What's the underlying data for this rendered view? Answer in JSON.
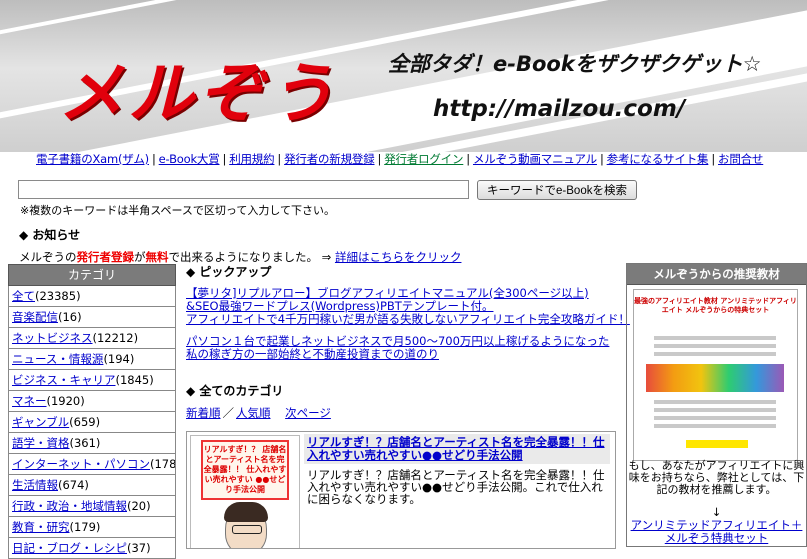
{
  "banner": {
    "logo": "メルぞう",
    "tagline": "全部タダ！e-Bookをザクザクゲット☆",
    "url": "http://mailzou.com/"
  },
  "nav": [
    {
      "label": "電子書籍のXam(ザム)"
    },
    {
      "label": "e-Book大賞"
    },
    {
      "label": "利用規約"
    },
    {
      "label": "発行者の新規登録"
    },
    {
      "label": "発行者ログイン"
    },
    {
      "label": "メルぞう動画マニュアル"
    },
    {
      "label": "参考になるサイト集"
    },
    {
      "label": "お問合せ"
    }
  ],
  "search": {
    "value": "",
    "button_label": "キーワードでe-Bookを検索",
    "note": "※複数のキーワードは半角スペースで区切って入力して下さい。"
  },
  "news": {
    "heading": "◆ お知らせ",
    "prefix": "メルぞうの",
    "red1": "発行者登録",
    "mid": "が",
    "red2": "無料",
    "suffix": "で出来るようになりました。 ⇒ ",
    "link": "詳細はこちらをクリック"
  },
  "left": {
    "heading": "カテゴリ",
    "categories": [
      {
        "label": "全て",
        "count": "(23385)"
      },
      {
        "label": "音楽配信",
        "count": "(16)"
      },
      {
        "label": "ネットビジネス",
        "count": "(12212)"
      },
      {
        "label": "ニュース・情報源",
        "count": "(194)"
      },
      {
        "label": "ビジネス・キャリア",
        "count": "(1845)"
      },
      {
        "label": "マネー",
        "count": "(1920)"
      },
      {
        "label": "ギャンブル",
        "count": "(659)"
      },
      {
        "label": "語学・資格",
        "count": "(361)"
      },
      {
        "label": "インターネット・パソコン",
        "count": "(1781)"
      },
      {
        "label": "生活情報",
        "count": "(674)"
      },
      {
        "label": "行政・政治・地域情報",
        "count": "(20)"
      },
      {
        "label": "教育・研究",
        "count": "(179)"
      },
      {
        "label": "日記・ブログ・レシピ",
        "count": "(37)"
      }
    ]
  },
  "pickup": {
    "heading": "◆ ピックアップ",
    "links": [
      "【夢リタ]リプルアロー】ブログアフィリエイトマニュアル(全300ページ以上)",
      "&SEO最強ワードプレス(Wordpress)PBTテンプレート付。",
      "アフィリエイトで4千万円稼いだ男が語る失敗しないアフィリエイト完全攻略ガイド！",
      "パソコン１台で起業しネットビジネスで月500〜700万円以上稼げるようになった",
      "私の稼ぎ方の一部始終と不動産投資までの道のり"
    ]
  },
  "all_categories": {
    "heading": "◆ 全てのカテゴリ",
    "sort_new": "新着順",
    "separator": "／",
    "sort_popular": "人気順",
    "next": "次ページ"
  },
  "book": {
    "cover_text": "リアルすぎ！？ 店舗名とアーティスト名を完全暴露！！ 仕入れやすい売れやすい ●●せどり手法公開",
    "title": "リアルすぎ！？店舗名とアーティスト名を完全暴露！！仕入れやすい売れやすい●●せどり手法公開",
    "description": "リアルすぎ！？店舗名とアーティスト名を完全暴露！！仕入れやすい売れやすい●●せどり手法公開。これで仕入れに困らなくなります。"
  },
  "right": {
    "heading": "メルぞうからの推奨教材",
    "promo_head": "最強のアフィリエイト教材 アンリミテッドアフィリエイト メルぞうからの特典セット",
    "text": "もし、あなたがアフィリエイトに興味をお持ちなら、弊社としては、下記の教材を推薦します。",
    "link_arrow": "↓",
    "link": "アンリミテッドアフィリエイト＋メルぞう特典セット"
  },
  "colors": {
    "logo_red": "#e1000c",
    "link_blue": "#0000cc",
    "nav_green": "#007a33",
    "header_gray": "#7b7b7b"
  }
}
